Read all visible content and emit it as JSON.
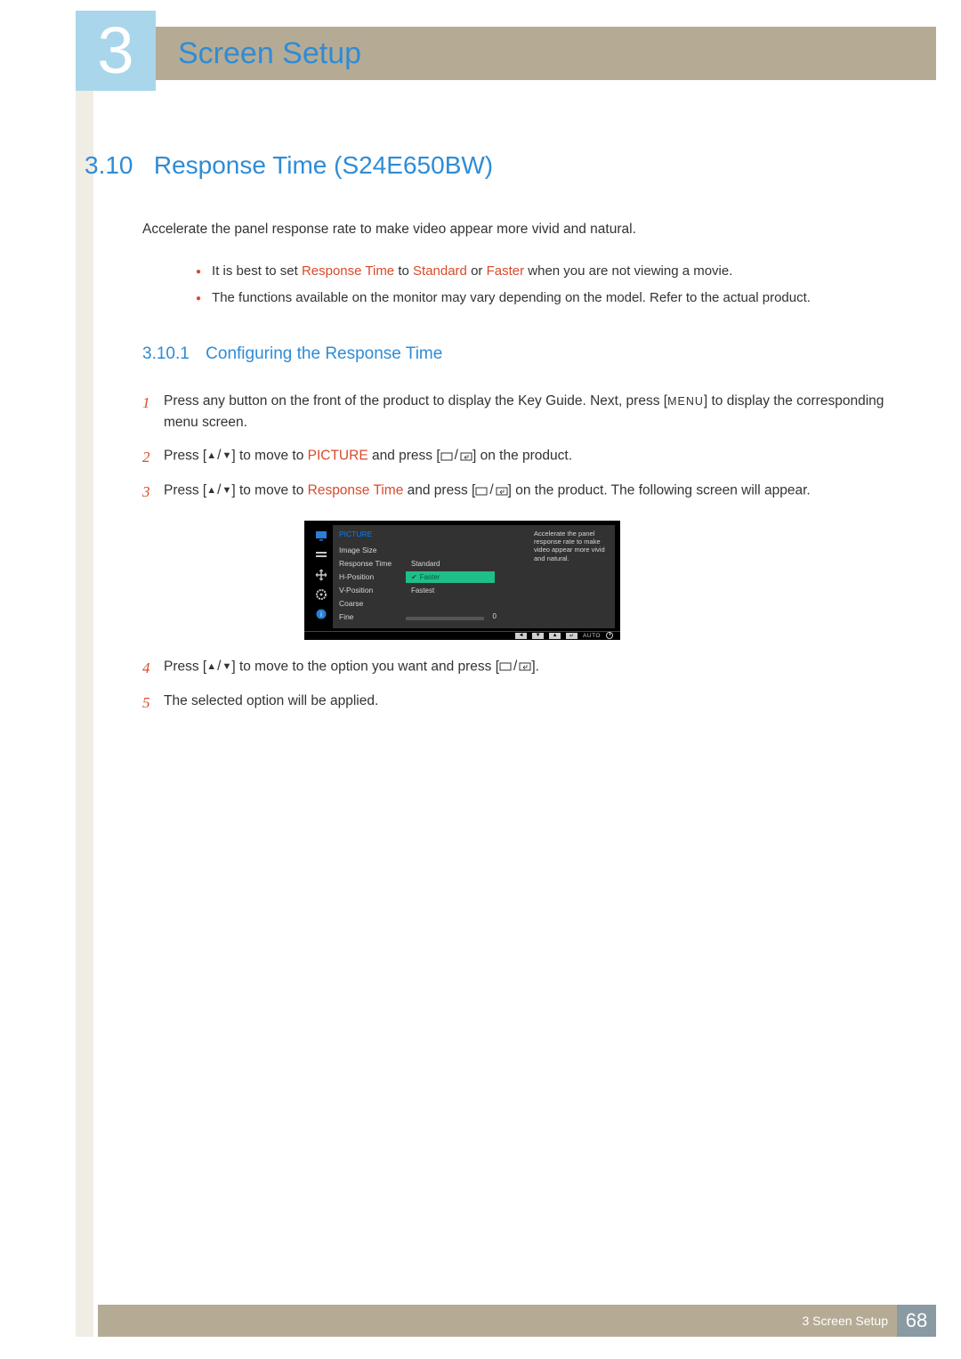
{
  "chapter": {
    "number": "3",
    "title": "Screen Setup"
  },
  "section": {
    "number": "3.10",
    "title": "Response Time (S24E650BW)"
  },
  "intro": "Accelerate the panel response rate to make video appear more vivid and natural.",
  "notes": {
    "b1_a": "It is best to set ",
    "b1_rt": "Response Time",
    "b1_b": " to ",
    "b1_std": "Standard",
    "b1_c": " or ",
    "b1_fast": "Faster",
    "b1_d": " when you are not viewing a movie.",
    "b2": "The functions available on the monitor may vary depending on the model. Refer to the actual product."
  },
  "subsection": {
    "number": "3.10.1",
    "title": "Configuring the Response Time"
  },
  "steps": {
    "s1_a": "Press any button on the front of the product to display the Key Guide. Next, press [",
    "s1_menu": "MENU",
    "s1_b": "] to display the corresponding menu screen.",
    "s2_a": "Press [",
    "s2_b": "] to move to ",
    "s2_pic": "PICTURE",
    "s2_c": " and press [",
    "s2_d": "] on the product.",
    "s3_a": "Press [",
    "s3_b": "] to move to ",
    "s3_rt": "Response Time",
    "s3_c": " and press [",
    "s3_d": "] on the product. The following screen will appear.",
    "s4_a": "Press [",
    "s4_b": "] to move to the option you want and press [",
    "s4_c": "].",
    "s5": "The selected option will be applied."
  },
  "osd": {
    "category": "PICTURE",
    "items": {
      "image_size": "Image Size",
      "response_time": "Response Time",
      "h_position": "H-Position",
      "v_position": "V-Position",
      "coarse": "Coarse",
      "fine": "Fine"
    },
    "options": {
      "standard": "Standard",
      "faster": "Faster",
      "fastest": "Fastest"
    },
    "fine_value": "0",
    "description": "Accelerate the panel response rate to make video appear more vivid and natural.",
    "auto": "AUTO"
  },
  "footer": {
    "text": "3 Screen Setup",
    "page": "68"
  }
}
